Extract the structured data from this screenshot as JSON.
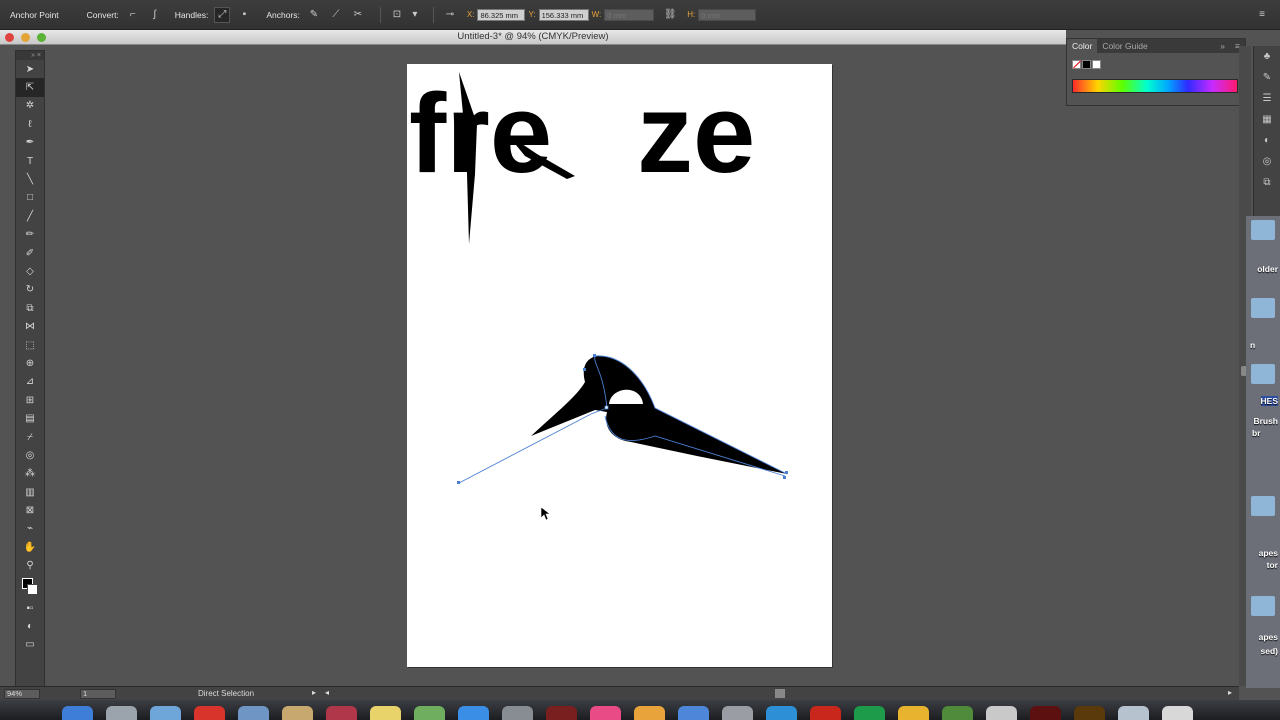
{
  "control_bar": {
    "mode_label": "Anchor Point",
    "convert_label": "Convert:",
    "handles_label": "Handles:",
    "anchors_label": "Anchors:",
    "x_label": "X:",
    "x_value": "86.325 mm",
    "y_label": "Y:",
    "y_value": "156.333 mm",
    "w_label": "W:",
    "w_value": "0 mm",
    "h_label": "H:",
    "h_value": "0 mm"
  },
  "document": {
    "title": "Untitled-3* @ 94% (CMYK/Preview)"
  },
  "tools_panel": {
    "items": [
      "selection-tool",
      "direct-selection-tool",
      "magic-wand-tool",
      "lasso-tool",
      "pen-tool",
      "type-tool",
      "line-tool",
      "rectangle-tool",
      "paintbrush-tool",
      "pencil-tool",
      "blob-brush-tool",
      "eraser-tool",
      "rotate-tool",
      "scale-tool",
      "width-tool",
      "free-transform-tool",
      "shape-builder-tool",
      "perspective-grid-tool",
      "mesh-tool",
      "gradient-tool",
      "eyedropper-tool",
      "blend-tool",
      "symbol-sprayer-tool",
      "column-graph-tool",
      "artboard-tool",
      "slice-tool",
      "hand-tool",
      "zoom-tool"
    ]
  },
  "color_panel": {
    "tabs": [
      "Color",
      "Color Guide"
    ]
  },
  "artwork": {
    "text_left": "fre",
    "text_right": "ze"
  },
  "desktop": {
    "labels": [
      "older",
      "n",
      "HES",
      "Brush",
      "br",
      "apes",
      "tor",
      "apes",
      "sed)"
    ]
  },
  "status_bar": {
    "zoom": "94%",
    "page": "1",
    "current_tool": "Direct Selection"
  },
  "colors": {
    "app_bg": "#535353",
    "panel_bg": "#434343",
    "selection_blue": "#4a7fd4",
    "coord_label": "#e8a23a"
  }
}
